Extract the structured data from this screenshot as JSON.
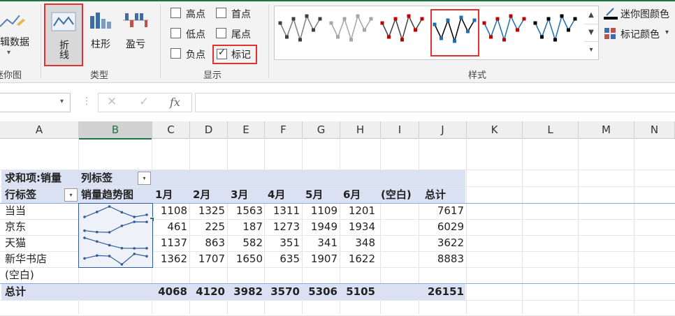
{
  "ribbon": {
    "edit_data": {
      "label": "编辑数据",
      "arrow": "▾"
    },
    "group_sparkline": "迷你图",
    "type_buttons": [
      {
        "label": "折线",
        "selected": true
      },
      {
        "label": "柱形",
        "selected": false
      },
      {
        "label": "盈亏",
        "selected": false
      }
    ],
    "group_type": "类型",
    "show_options": [
      {
        "label": "高点",
        "checked": false
      },
      {
        "label": "首点",
        "checked": false
      },
      {
        "label": "低点",
        "checked": false
      },
      {
        "label": "尾点",
        "checked": false
      },
      {
        "label": "负点",
        "checked": false
      },
      {
        "label": "标记",
        "checked": true
      }
    ],
    "group_show": "显示",
    "group_style": "样式",
    "sparkline_color": "迷你图颜色",
    "marker_color": "标记颜色",
    "styles": [
      {
        "line": "#7f7f7f",
        "marker": "#404040"
      },
      {
        "line": "#a6a6a6",
        "marker": "#a6a6a6"
      },
      {
        "line": "#404040",
        "marker": "#c00000"
      },
      {
        "line": "#000000",
        "marker": "#1f6fb2"
      },
      {
        "line": "#1f6fb2",
        "marker": "#c00000"
      },
      {
        "line": "#1f6fb2",
        "marker": "#000000"
      }
    ],
    "selected_style": 3
  },
  "formula_bar": {
    "fx": "fx",
    "cancel": "✕",
    "confirm": "✓"
  },
  "columns": [
    "A",
    "B",
    "C",
    "D",
    "E",
    "F",
    "G",
    "H",
    "I",
    "J",
    "K",
    "L",
    "M",
    "N"
  ],
  "selected_column": "B",
  "pivot": {
    "row1": {
      "value_label": "求和项:销量",
      "col_label": "列标签"
    },
    "header": {
      "row_label": "行标签",
      "trend": "销量趋势图",
      "months": [
        "1月",
        "2月",
        "3月",
        "4月",
        "5月",
        "6月"
      ],
      "blank": "(空白)",
      "total": "总计"
    },
    "rows": [
      {
        "name": "当当",
        "values": [
          1108,
          1325,
          1563,
          1311,
          1109,
          1201
        ],
        "total": 7617
      },
      {
        "name": "京东",
        "values": [
          461,
          225,
          187,
          1273,
          1949,
          1934
        ],
        "total": 6029
      },
      {
        "name": "天猫",
        "values": [
          1137,
          863,
          582,
          351,
          341,
          348
        ],
        "total": 3622
      },
      {
        "name": "新华书店",
        "values": [
          1362,
          1707,
          1650,
          635,
          1907,
          1622
        ],
        "total": 8883
      }
    ],
    "blank_row": "(空白)",
    "total_row": {
      "name": "总计",
      "values": [
        4068,
        4120,
        3982,
        3570,
        5306,
        5105
      ],
      "total": 26151
    },
    "colors": {
      "header_bg": "#d9e1f2",
      "sparkline": "#2e5c9a"
    }
  }
}
